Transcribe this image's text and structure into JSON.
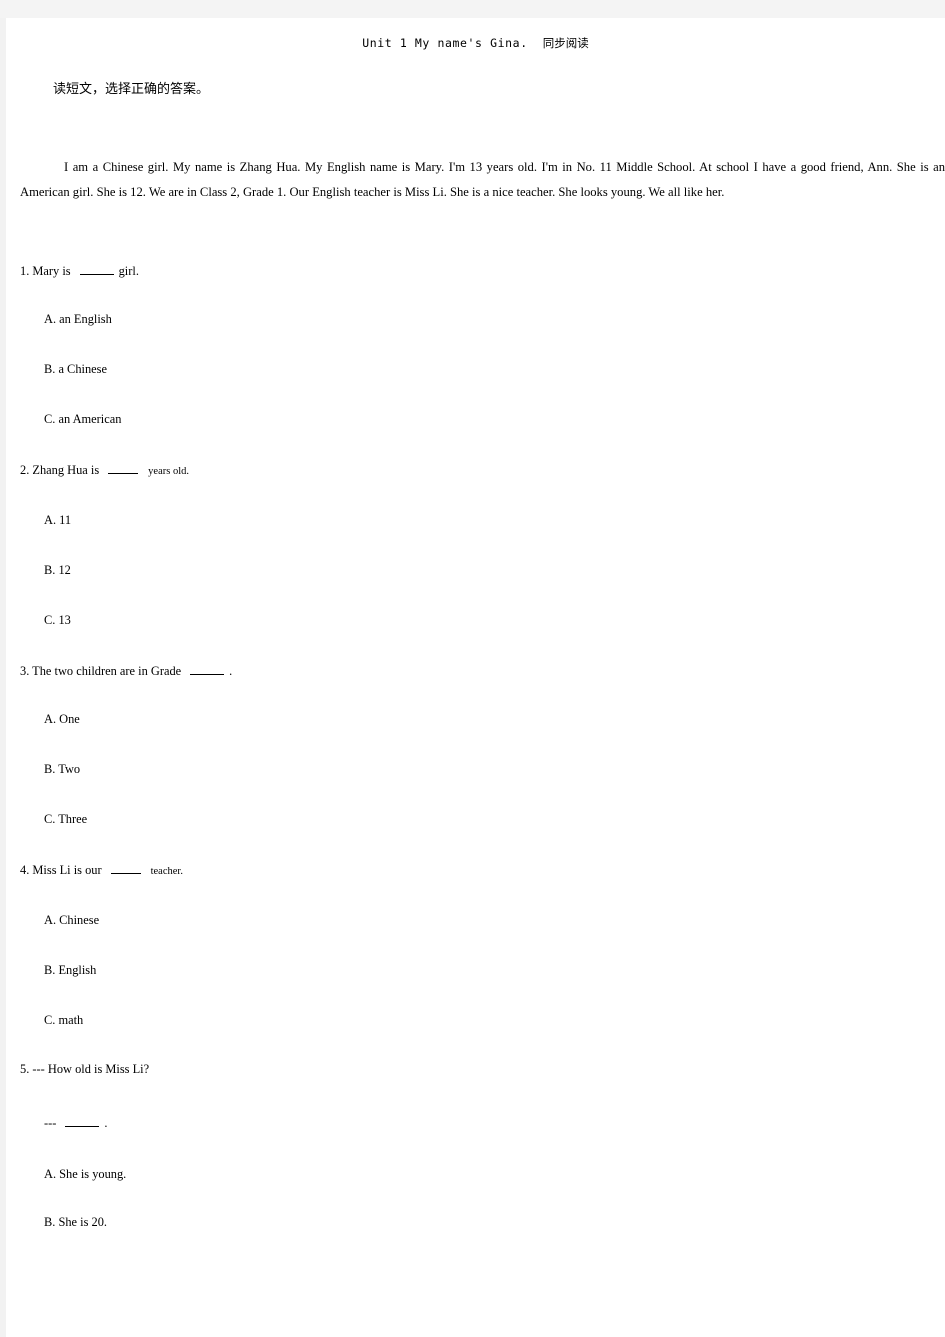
{
  "header": {
    "title_latin": "Unit 1 My name's Gina.",
    "title_cjk": "同步阅读"
  },
  "instruction": "读短文，选择正确的答案。",
  "passage": "I am a Chinese girl. My name is Zhang Hua. My English name is Mary. I'm 13 years old. I'm in No. 11 Middle School. At school I have a good friend, Ann. She is an American girl. She is 12. We are in Class 2, Grade 1. Our English teacher is Miss Li. She is a nice teacher. She looks young. We all like her.",
  "questions": [
    {
      "number": "1.",
      "stem_before": "Mary is",
      "stem_after": "girl.",
      "stem_after_small": false,
      "options": [
        "A.  an English",
        "B.  a Chinese",
        "C.  an American"
      ]
    },
    {
      "number": "2.",
      "stem_before": "Zhang Hua is",
      "stem_after": "years old.",
      "stem_after_small": true,
      "options": [
        "A.  11",
        "B.  12",
        "C.  13"
      ]
    },
    {
      "number": "3.",
      "stem_before": "The two children are in Grade",
      "stem_after": ".",
      "stem_after_small": false,
      "options": [
        "A.  One",
        "B.  Two",
        "C.  Three"
      ]
    },
    {
      "number": "4.",
      "stem_before": "Miss Li is our",
      "stem_after": "teacher.",
      "stem_after_small": true,
      "options": [
        "A.  Chinese",
        "B. English",
        "C.  math"
      ]
    },
    {
      "number": "5.",
      "stem_before": "--- How old is Miss Li?",
      "answer_line_dash": "---",
      "answer_line_tail": ".",
      "options": [
        "A.  She is young.",
        "B. She is 20."
      ]
    }
  ]
}
